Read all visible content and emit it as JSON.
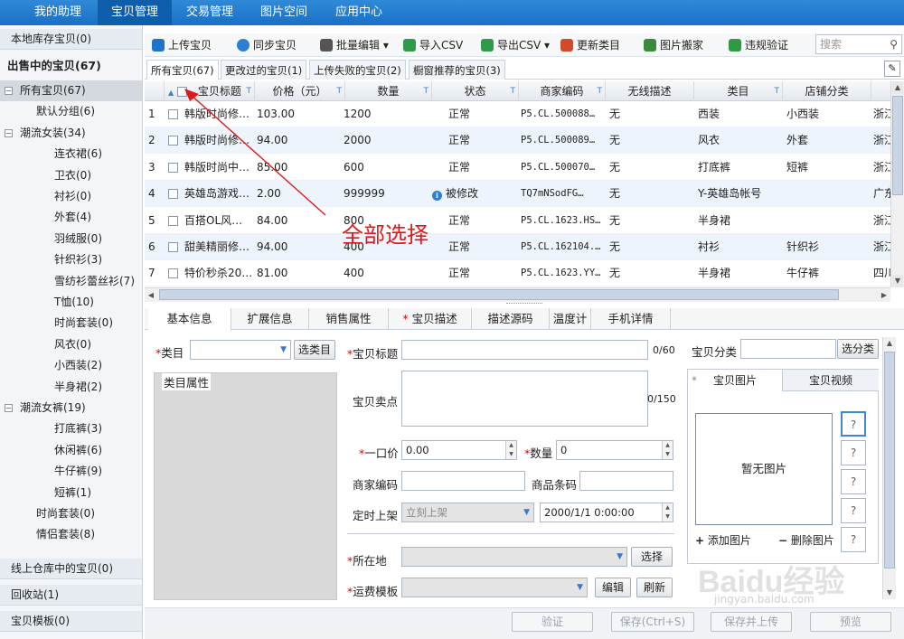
{
  "topnav": [
    "我的助理",
    "宝贝管理",
    "交易管理",
    "图片空间",
    "应用中心"
  ],
  "sidebar": {
    "local": "本地库存宝贝(0)",
    "onsale": "出售中的宝贝(67)",
    "tree": [
      {
        "label": "所有宝贝(67)",
        "toggle": "−"
      },
      {
        "label": "默认分组(6)"
      },
      {
        "label": "潮流女装(34)",
        "toggle": "−"
      },
      {
        "label": "连衣裙(6)"
      },
      {
        "label": "卫衣(0)"
      },
      {
        "label": "衬衫(0)"
      },
      {
        "label": "外套(4)"
      },
      {
        "label": "羽绒服(0)"
      },
      {
        "label": "针织衫(3)"
      },
      {
        "label": "雪纺衫蕾丝衫(7)"
      },
      {
        "label": "T恤(10)"
      },
      {
        "label": "时尚套装(0)"
      },
      {
        "label": "风衣(0)"
      },
      {
        "label": "小西装(2)"
      },
      {
        "label": "半身裙(2)"
      },
      {
        "label": "潮流女裤(19)",
        "toggle": "−"
      },
      {
        "label": "打底裤(3)"
      },
      {
        "label": "休闲裤(6)"
      },
      {
        "label": "牛仔裤(9)"
      },
      {
        "label": "短裤(1)"
      },
      {
        "label": "时尚套装(0)"
      },
      {
        "label": "情侣套装(8)"
      }
    ],
    "online": "线上仓库中的宝贝(0)",
    "recycle": "回收站(1)",
    "template": "宝贝模板(0)"
  },
  "toolbar": [
    "上传宝贝",
    "同步宝贝",
    "批量编辑",
    "导入CSV",
    "导出CSV",
    "更新类目",
    "图片搬家",
    "违规验证"
  ],
  "search_placeholder": "搜索",
  "subtabs": [
    "所有宝贝(67)",
    "更改过的宝贝(1)",
    "上传失败的宝贝(2)",
    "橱窗推荐的宝贝(3)"
  ],
  "columns": [
    "宝贝标题",
    "价格（元）",
    "数量",
    "状态",
    "商家编码",
    "无线描述",
    "类目",
    "店铺分类"
  ],
  "rows": [
    {
      "n": "1",
      "title": "韩版时尚修…",
      "price": "103.00",
      "qty": "1200",
      "status": "正常",
      "code": "P5.CL.500088…",
      "wx": "无",
      "cat": "西装",
      "shop": "小西装",
      "ext": "浙江"
    },
    {
      "n": "2",
      "title": "韩版时尚修…",
      "price": "94.00",
      "qty": "2000",
      "status": "正常",
      "code": "P5.CL.500089…",
      "wx": "无",
      "cat": "风衣",
      "shop": "外套",
      "ext": "浙江"
    },
    {
      "n": "3",
      "title": "韩版时尚中…",
      "price": "85.00",
      "qty": "600",
      "status": "正常",
      "code": "P5.CL.500070…",
      "wx": "无",
      "cat": "打底裤",
      "shop": "短裤",
      "ext": "浙江"
    },
    {
      "n": "4",
      "title": "英雄岛游戏…",
      "price": "2.00",
      "qty": "999999",
      "status": "被修改",
      "code": "TQ7mNSodFG…",
      "wx": "无",
      "cat": "Y-英雄岛帐号",
      "shop": "",
      "ext": "广东",
      "info": true
    },
    {
      "n": "5",
      "title": "百搭OL风…",
      "price": "84.00",
      "qty": "800",
      "status": "正常",
      "code": "P5.CL.1623.HS…",
      "wx": "无",
      "cat": "半身裙",
      "shop": "",
      "ext": "浙江"
    },
    {
      "n": "6",
      "title": "甜美精丽修…",
      "price": "94.00",
      "qty": "400",
      "status": "正常",
      "code": "P5.CL.162104.…",
      "wx": "无",
      "cat": "衬衫",
      "shop": "针织衫",
      "ext": "浙江"
    },
    {
      "n": "7",
      "title": "特价秒杀20…",
      "price": "81.00",
      "qty": "400",
      "status": "正常",
      "code": "P5.CL.1623.YY…",
      "wx": "无",
      "cat": "半身裙",
      "shop": "牛仔裤",
      "ext": "四川"
    }
  ],
  "annotation": "全部选择",
  "detail_tabs": [
    "基本信息",
    "扩展信息",
    "销售属性",
    "宝贝描述",
    "描述源码",
    "温度计",
    "手机详情"
  ],
  "form": {
    "category": "类目",
    "select_cat": "选类目",
    "cat_props": "类目属性",
    "title": "宝贝标题",
    "title_count": "0/60",
    "shop_cat": "宝贝分类",
    "select_shop_cat": "选分类",
    "selling": "宝贝卖点",
    "selling_count": "0/150",
    "price": "一口价",
    "price_val": "0.00",
    "qty": "数量",
    "qty_val": "0",
    "code": "商家编码",
    "barcode": "商品条码",
    "timing": "定时上架",
    "timing_val": "立刻上架",
    "datetime": "2000/1/1 0:00:00",
    "location": "所在地",
    "choose": "选择",
    "shipping": "运费模板",
    "edit": "编辑",
    "refresh": "刷新"
  },
  "media": {
    "tab_pic": "宝贝图片",
    "tab_video": "宝贝视频",
    "none": "暂无图片",
    "add": "添加图片",
    "del": "删除图片",
    "q": "?"
  },
  "bottom": [
    "验证",
    "保存(Ctrl+S)",
    "保存并上传",
    "预览"
  ],
  "watermark": "Baidu经验",
  "watermark_url": "jingyan.baidu.com"
}
